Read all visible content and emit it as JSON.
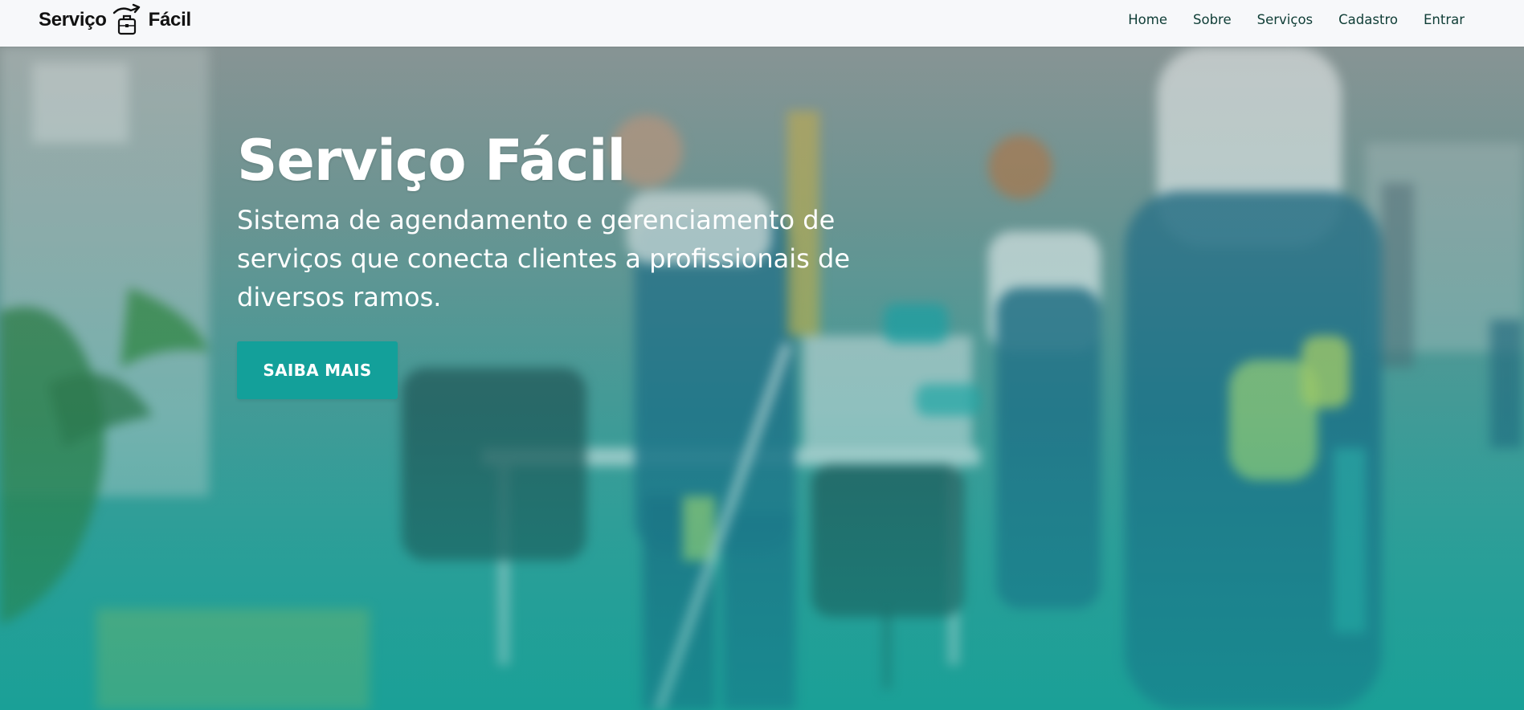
{
  "brand": {
    "word_left": "Serviço",
    "word_right": "Fácil",
    "logo_icon": "briefcase-arrow-icon"
  },
  "nav": {
    "items": [
      {
        "label": "Home"
      },
      {
        "label": "Sobre"
      },
      {
        "label": "Serviços"
      },
      {
        "label": "Cadastro"
      },
      {
        "label": "Entrar"
      }
    ]
  },
  "hero": {
    "title": "Serviço Fácil",
    "subtitle": "Sistema de agendamento e gerenciamento de serviços que conecta clientes a profissionais de diversos ramos.",
    "cta_label": "SAIBA MAIS",
    "background_image": "blurred-cleaning-team-photo"
  },
  "colors": {
    "accent": "#13a09a",
    "nav_text": "#0f3d36",
    "navbar_bg": "#f7f8fa"
  }
}
